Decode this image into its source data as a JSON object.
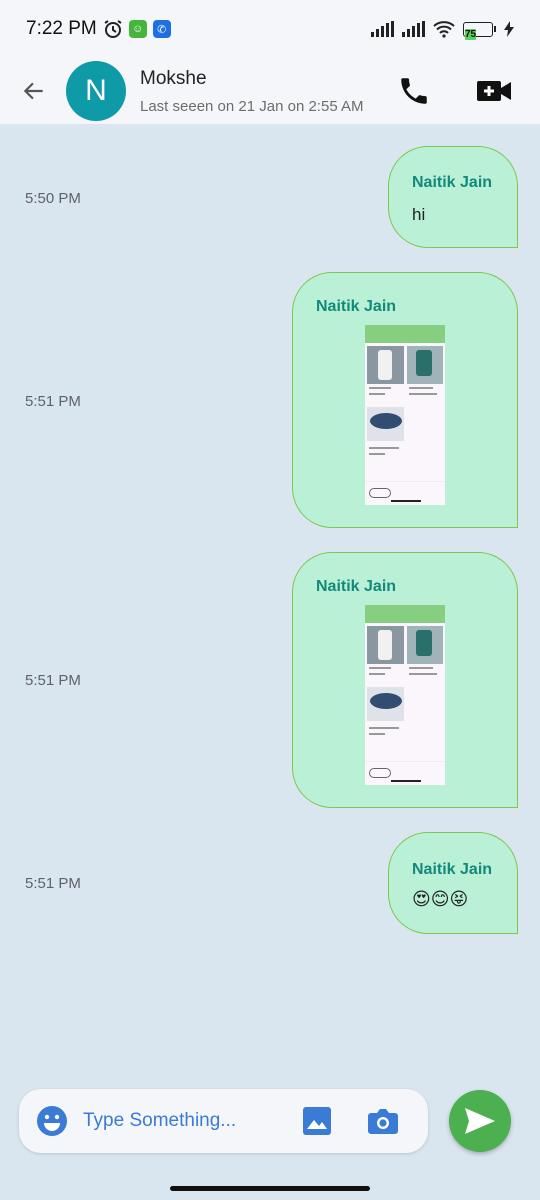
{
  "status_bar": {
    "time": "7:22 PM",
    "battery": "75"
  },
  "header": {
    "avatar_letter": "N",
    "contact_name": "Mokshe",
    "last_seen": "Last seeen on 21 Jan on 2:55 AM"
  },
  "messages": [
    {
      "time": "5:50 PM",
      "sender": "Naitik Jain",
      "type": "text",
      "text": "hi"
    },
    {
      "time": "5:51 PM",
      "sender": "Naitik Jain",
      "type": "image"
    },
    {
      "time": "5:51 PM",
      "sender": "Naitik Jain",
      "type": "image"
    },
    {
      "time": "5:51 PM",
      "sender": "Naitik Jain",
      "type": "text",
      "text": "😍😊😝"
    }
  ],
  "composer": {
    "placeholder": "Type Something..."
  },
  "colors": {
    "bubble": "#b9f0d6",
    "bubble_border": "#7cc84f",
    "sender": "#12897b",
    "accent": "#3a7bd5",
    "send": "#4caf50",
    "avatar": "#0e9aa7"
  }
}
